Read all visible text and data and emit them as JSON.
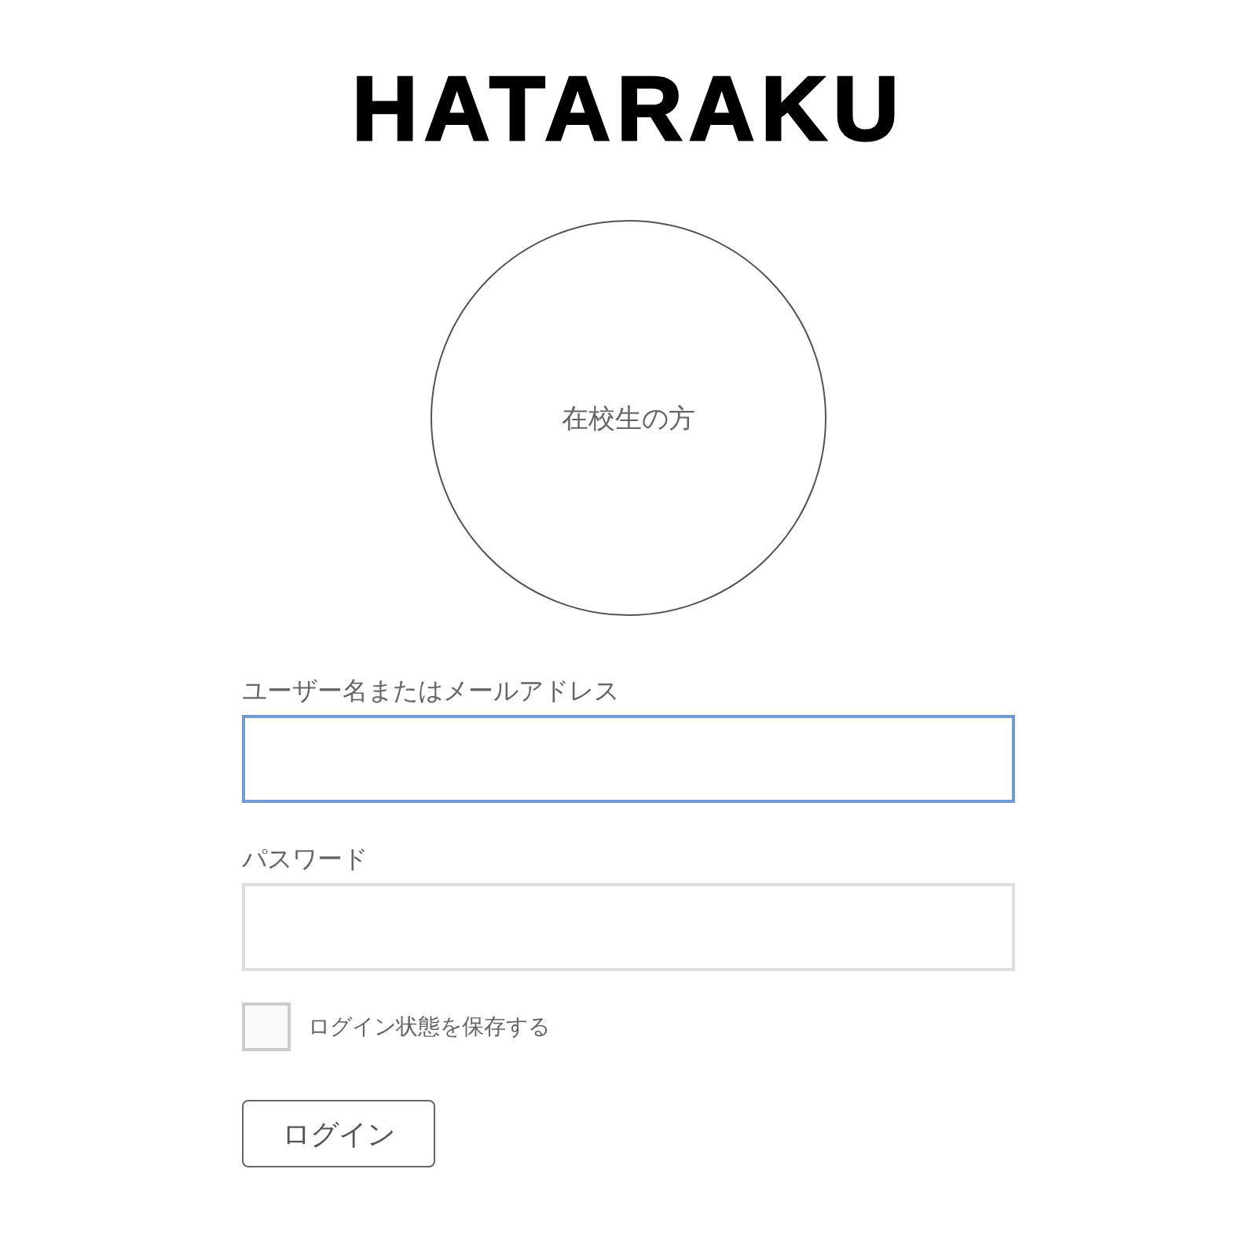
{
  "logo": "HATARAKU",
  "role_circle": {
    "label": "在校生の方"
  },
  "fields": [
    {
      "label": "ユーザー名またはメールアドレス",
      "focused": true
    },
    {
      "label": "パスワード",
      "focused": false
    }
  ],
  "remember": {
    "label": "ログイン状態を保存する",
    "checked": false
  },
  "login_button": "ログイン"
}
